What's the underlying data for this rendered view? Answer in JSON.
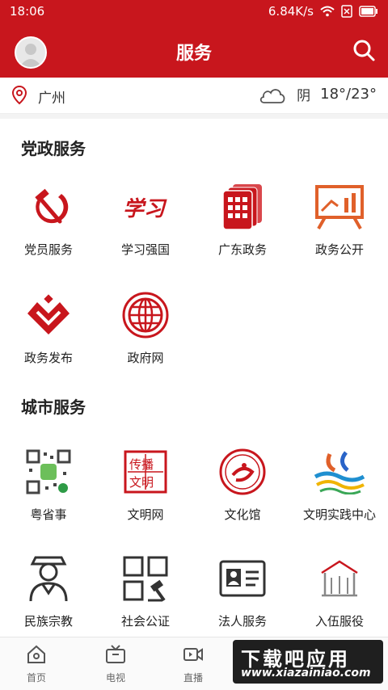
{
  "status_bar": {
    "time": "18:06",
    "network_speed": "6.84K/s"
  },
  "header": {
    "title": "服务"
  },
  "location_bar": {
    "city": "广州",
    "weather": "阴",
    "temperature": "18°/23°"
  },
  "sections": [
    {
      "title": "党政服务",
      "items": [
        {
          "label": "党员服务",
          "icon": "hammer-sickle-icon"
        },
        {
          "label": "学习强国",
          "icon": "xuexi-logo-icon"
        },
        {
          "label": "广东政务",
          "icon": "gov-grid-icon"
        },
        {
          "label": "政务公开",
          "icon": "presentation-board-icon"
        },
        {
          "label": "政务发布",
          "icon": "heart-diamond-icon"
        },
        {
          "label": "政府网",
          "icon": "globe-icon"
        }
      ]
    },
    {
      "title": "城市服务",
      "items": [
        {
          "label": "粤省事",
          "icon": "qr-code-icon"
        },
        {
          "label": "文明网",
          "icon": "seal-stamp-icon"
        },
        {
          "label": "文化馆",
          "icon": "culture-hall-icon"
        },
        {
          "label": "文明实践中心",
          "icon": "wave-logo-icon"
        },
        {
          "label": "民族宗教",
          "icon": "person-scarf-icon"
        },
        {
          "label": "社会公证",
          "icon": "gavel-grid-icon"
        },
        {
          "label": "法人服务",
          "icon": "id-card-icon"
        },
        {
          "label": "入伍服役",
          "icon": "military-building-icon"
        }
      ]
    }
  ],
  "tab_bar": [
    {
      "label": "首页",
      "icon": "home-icon"
    },
    {
      "label": "电视",
      "icon": "tv-icon"
    },
    {
      "label": "直播",
      "icon": "video-camera-icon"
    }
  ],
  "watermark": {
    "line1": "下载吧应用",
    "line2": "www.xiazainiao.com"
  },
  "colors": {
    "primary_red": "#c8161d",
    "text": "#222222",
    "accent_orange": "#e0602a"
  }
}
